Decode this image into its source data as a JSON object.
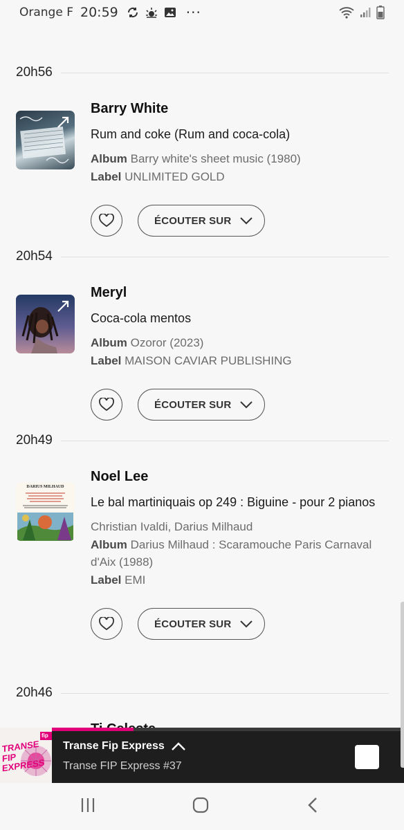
{
  "status_bar": {
    "carrier": "Orange F",
    "time": "20:59",
    "more": "···"
  },
  "slots": [
    {
      "time": "20h56",
      "artist": "Barry White",
      "title": "Rum and coke (Rum and coca-cola)",
      "performers": "",
      "album_label": "Album",
      "album": "Barry white's sheet music (1980)",
      "label_label": "Label",
      "label": "UNLIMITED GOLD",
      "listen_button": "ÉCOUTER SUR"
    },
    {
      "time": "20h54",
      "artist": "Meryl",
      "title": "Coca-cola mentos",
      "performers": "",
      "album_label": "Album",
      "album": "Ozoror (2023)",
      "label_label": "Label",
      "label": "MAISON CAVIAR PUBLISHING",
      "listen_button": "ÉCOUTER SUR"
    },
    {
      "time": "20h49",
      "artist": "Noel Lee",
      "title": "Le bal martiniquais op 249 : Biguine - pour 2 pianos",
      "performers": "Christian Ivaldi, Darius Milhaud",
      "album_label": "Album",
      "album": "Darius Milhaud : Scaramouche Paris Carnaval d'Aix (1988)",
      "label_label": "Label",
      "label": "EMI",
      "listen_button": "ÉCOUTER SUR",
      "cover_text": "DARIUS MILHAUD"
    },
    {
      "time": "20h46",
      "artist": "Ti Celeste"
    }
  ],
  "player": {
    "title": "Transe Fip Express",
    "subtitle": "Transe FIP Express #37",
    "progress": 0.33,
    "cover_lines": [
      "TRANSE",
      "FIP",
      "EXPRESS"
    ],
    "cover_brand": "fip"
  },
  "colors": {
    "accent": "#e2007a",
    "background": "#f7f7f7",
    "player_bg": "#1e1e1e"
  }
}
